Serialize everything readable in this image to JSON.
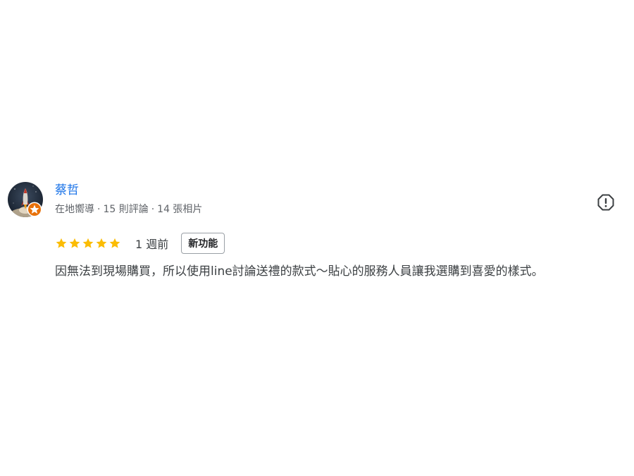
{
  "reviewer": {
    "name": "蔡哲",
    "badge_label": "在地嚮導",
    "review_count": "15 則評論",
    "photo_count": "14 張相片",
    "separator": "·",
    "avatar_icon": "rocket-avatar-icon",
    "badge_icon": "local-guide-star-icon"
  },
  "review": {
    "rating": 5,
    "rating_max": 5,
    "date": "1 週前",
    "new_feature_label": "新功能",
    "text": "因無法到現場購買，所以使用line討論送禮的款式～貼心的服務人員讓我選購到喜愛的樣式。"
  },
  "actions": {
    "report_icon": "report-icon"
  },
  "colors": {
    "name": "#1a73e8",
    "meta": "#5f6368",
    "star": "#fbbc04",
    "badge": "#e8710a",
    "text": "#3c4043"
  }
}
